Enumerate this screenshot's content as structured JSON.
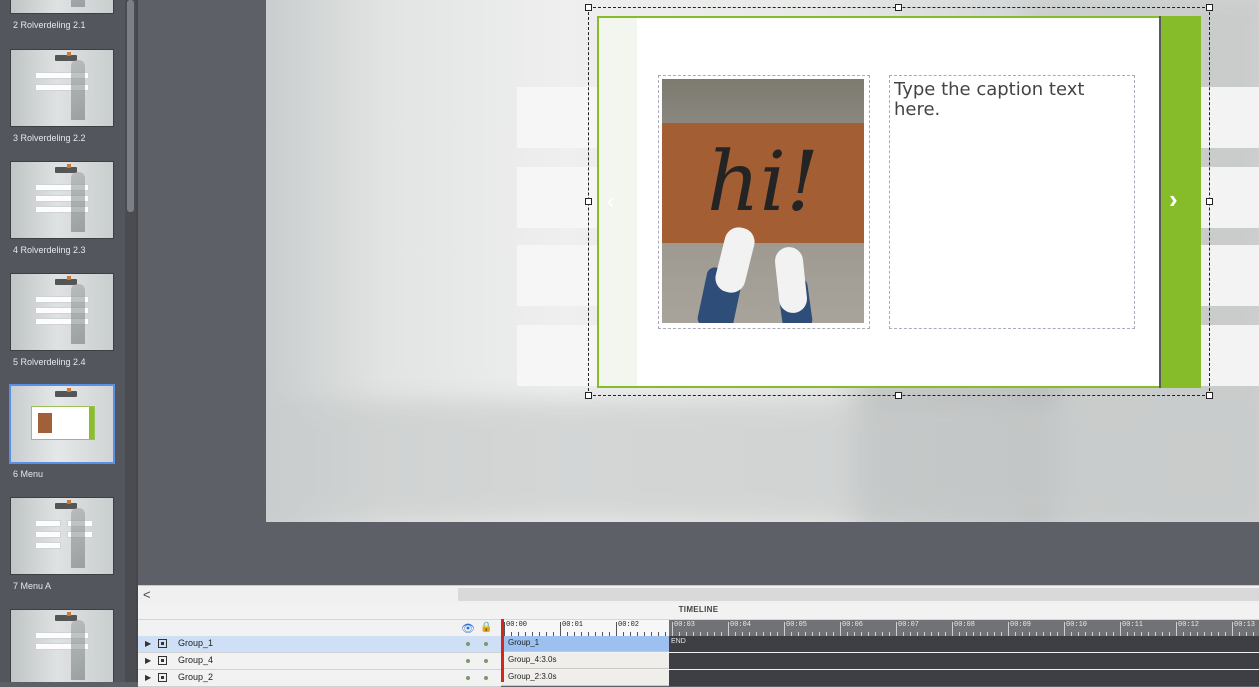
{
  "filmstrip": {
    "slides": [
      {
        "label": "2 Rolverdeling 2.1",
        "active": false
      },
      {
        "label": "3 Rolverdeling 2.2",
        "active": false
      },
      {
        "label": "4 Rolverdeling 2.3",
        "active": false
      },
      {
        "label": "5 Rolverdeling 2.4",
        "active": false
      },
      {
        "label": "6 Menu",
        "active": true
      },
      {
        "label": "7 Menu A",
        "active": false
      }
    ]
  },
  "slideshow_widget": {
    "prev_glyph": "‹",
    "next_glyph": "›",
    "image_text": "hi!",
    "caption_placeholder": "Type the caption text here."
  },
  "scrollbar": {
    "left_glyph": "<"
  },
  "timeline": {
    "title": "TIMELINE",
    "ticks": [
      "00:00",
      "00:01",
      "00:02",
      "00:03",
      "00:04",
      "00:05",
      "00:06",
      "00:07",
      "00:08",
      "00:09",
      "00:10",
      "00:11",
      "00:12",
      "00:13"
    ],
    "end_label": "END",
    "rows": [
      {
        "name": "Group_1",
        "bar_label": "Group_1",
        "selected": true
      },
      {
        "name": "Group_4",
        "bar_label": "Group_4:3.0s",
        "selected": false
      },
      {
        "name": "Group_2",
        "bar_label": "Group_2:3.0s",
        "selected": false
      }
    ]
  },
  "colors": {
    "accent_green": "#86bc2a",
    "selection_blue": "#5b8fe6",
    "playhead_red": "#d0281b"
  }
}
